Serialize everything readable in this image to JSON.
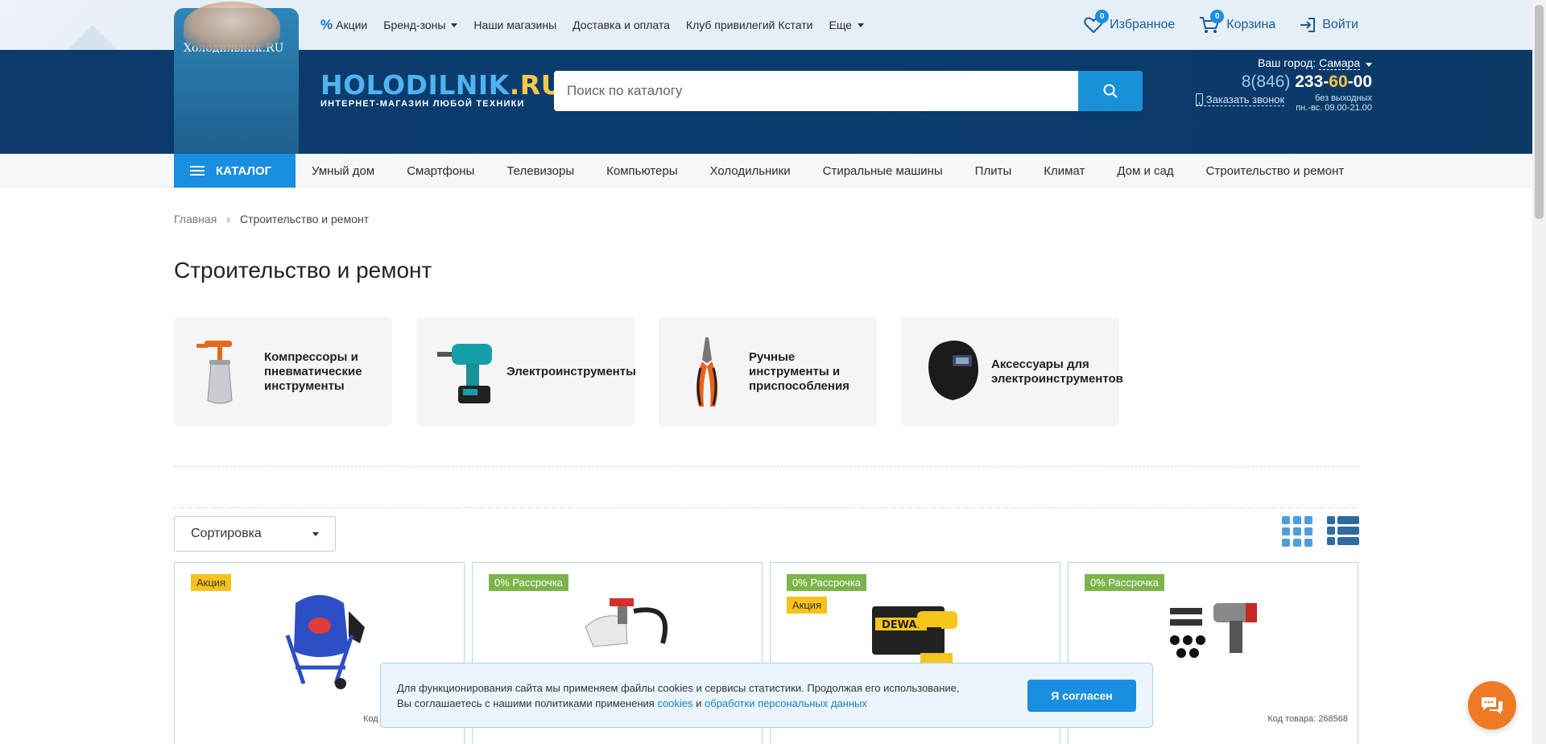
{
  "topnav": {
    "items": [
      {
        "label": "Акции",
        "icon": "percent-icon"
      },
      {
        "label": "Бренд-зоны",
        "dropdown": true
      },
      {
        "label": "Наши магазины"
      },
      {
        "label": "Доставка и оплата"
      },
      {
        "label": "Клуб привилегий Кстати"
      },
      {
        "label": "Еще",
        "dropdown": true
      }
    ]
  },
  "user": {
    "favorites_label": "Избранное",
    "favorites_count": "0",
    "cart_label": "Корзина",
    "cart_count": "0",
    "login_label": "Войти"
  },
  "brand": {
    "fridge_label": "Холодильник.RU",
    "logo_main": "HOLODILNIK",
    "logo_tld": ".RU",
    "tagline": "ИНТЕРНЕТ-МАГАЗИН ЛЮБОЙ ТЕХНИКИ"
  },
  "search": {
    "placeholder": "Поиск по каталогу"
  },
  "contact": {
    "city_label": "Ваш город:",
    "city_value": "Самара",
    "phone_prefix": "8(846) ",
    "phone_main": "233-",
    "phone_highlight": "60",
    "phone_end": "-00",
    "callback_label": "Заказать звонок",
    "hours_line1": "без выходных",
    "hours_line2": "пн.-вс. 09.00-21.00"
  },
  "catnav": {
    "catalog_label": "КАТАЛОГ",
    "items": [
      "Умный дом",
      "Смартфоны",
      "Телевизоры",
      "Компьютеры",
      "Холодильники",
      "Стиральные машины",
      "Плиты",
      "Климат",
      "Дом и сад",
      "Строительство и ремонт"
    ]
  },
  "breadcrumb": {
    "home": "Главная",
    "current": "Строительство и ремонт"
  },
  "page_title": "Строительство и ремонт",
  "subcategories": [
    {
      "name": "Компрессоры и пневматические инструменты",
      "icon": "spray-gun-icon"
    },
    {
      "name": "Электроинструменты",
      "icon": "drill-icon"
    },
    {
      "name": "Ручные инструменты и приспособления",
      "icon": "pliers-icon"
    },
    {
      "name": "Аксессуары для электроинструментов",
      "icon": "welding-mask-icon"
    }
  ],
  "sort": {
    "label": "Сортировка"
  },
  "products": [
    {
      "tags": [
        {
          "text": "Акция",
          "kind": "sale"
        }
      ],
      "code": "Код",
      "image": "concrete-mixer-icon"
    },
    {
      "tags": [
        {
          "text": "0% Рассрочка",
          "kind": "inst"
        }
      ],
      "code": "",
      "image": "paint-sprayer-icon"
    },
    {
      "tags": [
        {
          "text": "0% Рассрочка",
          "kind": "inst"
        },
        {
          "text": "Акция",
          "kind": "sale"
        }
      ],
      "code": "",
      "image": "dewalt-drill-icon"
    },
    {
      "tags": [
        {
          "text": "0% Рассрочка",
          "kind": "inst"
        }
      ],
      "code": "Код товара: 268568",
      "image": "impact-wrench-icon"
    }
  ],
  "cookie": {
    "line1": "Для функционирования сайта мы применяем файлы cookies и сервисы статистики. Продолжая его использование,",
    "line2_pre": "Вы соглашаетесь с нашими политиками применения ",
    "link1": "cookies",
    "line2_mid": " и ",
    "link2": "обработки персональных данных",
    "agree_label": "Я согласен"
  },
  "colors": {
    "accent": "#1a8ee0",
    "header_bg": "#0b3a67",
    "sale": "#f9c21b",
    "installment": "#7bb54a",
    "chat": "#ee7a25"
  }
}
